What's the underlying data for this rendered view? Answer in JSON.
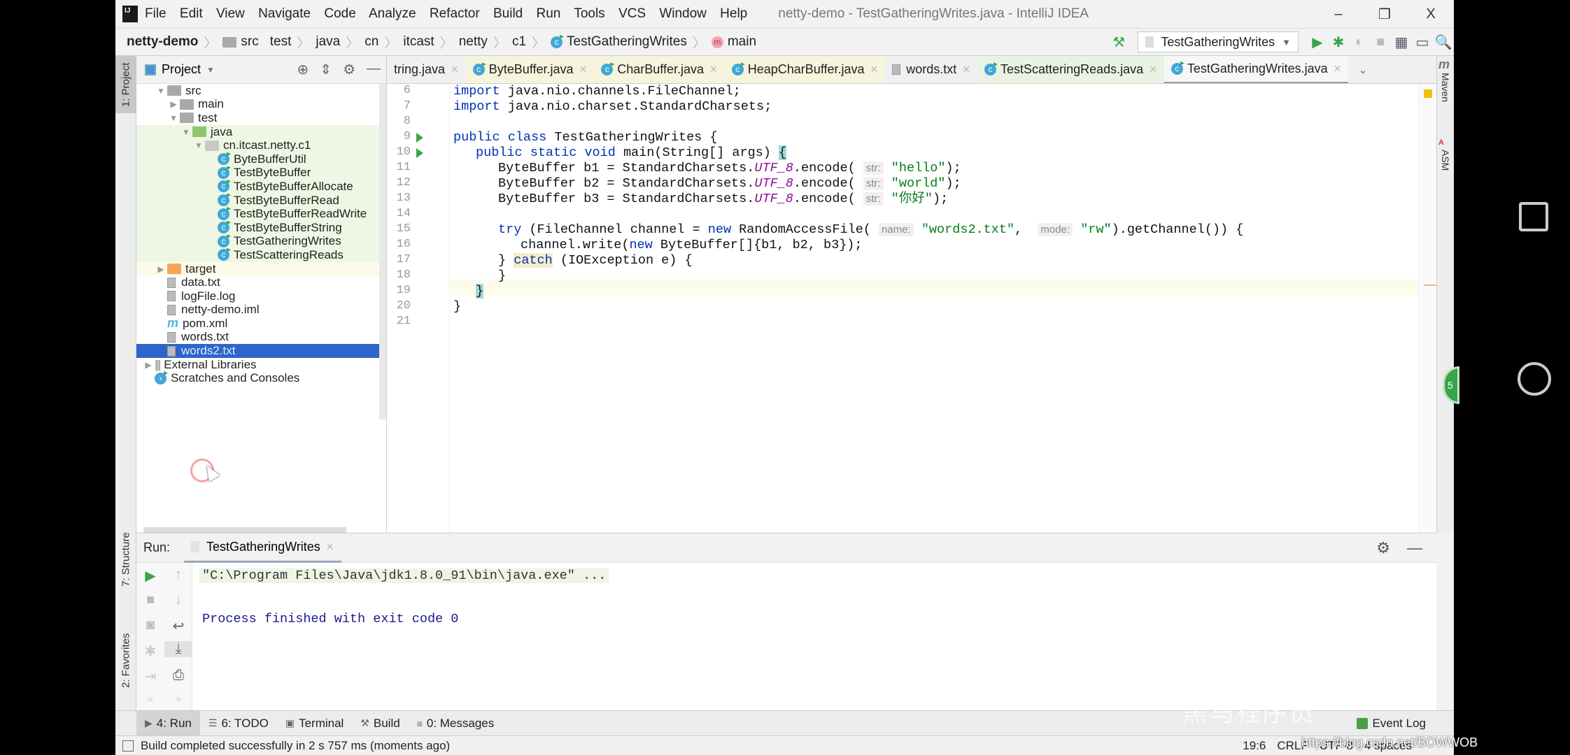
{
  "window": {
    "title": "netty-demo - TestGatheringWrites.java - IntelliJ IDEA",
    "menu": [
      "File",
      "Edit",
      "View",
      "Navigate",
      "Code",
      "Analyze",
      "Refactor",
      "Build",
      "Run",
      "Tools",
      "VCS",
      "Window",
      "Help"
    ],
    "controls": {
      "minimize": "–",
      "restore": "❐",
      "close": "X"
    }
  },
  "navbar": {
    "breadcrumb": [
      "netty-demo",
      "src",
      "test",
      "java",
      "cn",
      "itcast",
      "netty",
      "c1",
      "TestGatheringWrites",
      "main"
    ],
    "run_config": "TestGatheringWrites"
  },
  "left_strip": {
    "project": "1: Project",
    "structure": "7: Structure",
    "favorites": "2: Favorites"
  },
  "project_pane": {
    "title": "Project",
    "tree": [
      {
        "label": "src",
        "indent": 1,
        "arrow": "down",
        "icon": "folder"
      },
      {
        "label": "main",
        "indent": 2,
        "arrow": "right",
        "icon": "folder"
      },
      {
        "label": "test",
        "indent": 2,
        "arrow": "down",
        "icon": "folder"
      },
      {
        "label": "java",
        "indent": 3,
        "arrow": "down",
        "icon": "java-folder"
      },
      {
        "label": "cn.itcast.netty.c1",
        "indent": 4,
        "arrow": "down",
        "icon": "package"
      },
      {
        "label": "ByteBufferUtil",
        "indent": 5,
        "icon": "class"
      },
      {
        "label": "TestByteBuffer",
        "indent": 5,
        "icon": "class"
      },
      {
        "label": "TestByteBufferAllocate",
        "indent": 5,
        "icon": "class"
      },
      {
        "label": "TestByteBufferRead",
        "indent": 5,
        "icon": "class"
      },
      {
        "label": "TestByteBufferReadWrite",
        "indent": 5,
        "icon": "class"
      },
      {
        "label": "TestByteBufferString",
        "indent": 5,
        "icon": "class"
      },
      {
        "label": "TestGatheringWrites",
        "indent": 5,
        "icon": "class"
      },
      {
        "label": "TestScatteringReads",
        "indent": 5,
        "icon": "class"
      },
      {
        "label": "target",
        "indent": 1,
        "arrow": "right",
        "icon": "target-folder"
      },
      {
        "label": "data.txt",
        "indent": 1,
        "icon": "file"
      },
      {
        "label": "logFile.log",
        "indent": 1,
        "icon": "file"
      },
      {
        "label": "netty-demo.iml",
        "indent": 1,
        "icon": "file"
      },
      {
        "label": "pom.xml",
        "indent": 1,
        "icon": "maven"
      },
      {
        "label": "words.txt",
        "indent": 1,
        "icon": "file"
      },
      {
        "label": "words2.txt",
        "indent": 1,
        "icon": "file",
        "selected": true
      },
      {
        "label": "External Libraries",
        "indent": 0,
        "arrow": "right",
        "icon": "library"
      },
      {
        "label": "Scratches and Consoles",
        "indent": 0,
        "icon": "scratches"
      }
    ]
  },
  "editor": {
    "tabs": [
      {
        "label": "String.java",
        "visible_label": "tring.java",
        "style": "plain"
      },
      {
        "label": "ByteBuffer.java",
        "style": "yellow"
      },
      {
        "label": "CharBuffer.java",
        "style": "yellow"
      },
      {
        "label": "HeapCharBuffer.java",
        "style": "yellow"
      },
      {
        "label": "words.txt",
        "style": "plain"
      },
      {
        "label": "TestScatteringReads.java",
        "style": "green"
      },
      {
        "label": "TestGatheringWrites.java",
        "style": "active"
      }
    ],
    "lines": [
      {
        "n": "6"
      },
      {
        "n": "7"
      },
      {
        "n": "8"
      },
      {
        "n": "9"
      },
      {
        "n": "10"
      },
      {
        "n": "11"
      },
      {
        "n": "12"
      },
      {
        "n": "13"
      },
      {
        "n": "14"
      },
      {
        "n": "15"
      },
      {
        "n": "16"
      },
      {
        "n": "17"
      },
      {
        "n": "18"
      },
      {
        "n": "19"
      },
      {
        "n": "20"
      },
      {
        "n": "21"
      }
    ],
    "code": {
      "l6": {
        "kw": "import",
        "rest": " java.nio.channels.FileChannel;"
      },
      "l7": {
        "kw": "import",
        "rest": " java.nio.charset.StandardCharsets;"
      },
      "l9": {
        "kw": "public class",
        "rest": " TestGatheringWrites {"
      },
      "l10": {
        "kw": "public static void",
        "rest": " main(String[] args) ",
        "brace": "{"
      },
      "l11": {
        "pre": "ByteBuffer b1 = StandardCharsets.",
        "it": "UTF_8",
        "post": ".encode( ",
        "hint": "str:",
        "str": "\"hello\"",
        "end": ");"
      },
      "l12": {
        "pre": "ByteBuffer b2 = StandardCharsets.",
        "it": "UTF_8",
        "post": ".encode( ",
        "hint": "str:",
        "str": "\"world\"",
        "end": ");"
      },
      "l13": {
        "pre": "ByteBuffer b3 = StandardCharsets.",
        "it": "UTF_8",
        "post": ".encode( ",
        "hint": "str:",
        "str": "\"你好\"",
        "end": ");"
      },
      "l15": {
        "kw": "try",
        "a": " (FileChannel channel = ",
        "kw2": "new",
        "b": " RandomAccessFile( ",
        "hint1": "name:",
        "str1": "\"words2.txt\"",
        "c": ",  ",
        "hint2": "mode:",
        "str2": "\"rw\"",
        "d": ").getChannel()) {"
      },
      "l16": {
        "a": "channel.write(",
        "kw": "new",
        "b": " ByteBuffer[]{b1, b2, b3});"
      },
      "l17": {
        "a": "} ",
        "kw": "catch",
        "b": " (IOException e) {"
      },
      "l18": {
        "a": "}"
      },
      "l19": {
        "brace": "}"
      },
      "l20": {
        "a": "}"
      }
    }
  },
  "right_strip": {
    "maven": "Maven",
    "asm": "ASM"
  },
  "run_panel": {
    "label": "Run:",
    "tab": "TestGatheringWrites",
    "console": {
      "command": "\"C:\\Program Files\\Java\\jdk1.8.0_91\\bin\\java.exe\" ...",
      "exit": "Process finished with exit code 0"
    }
  },
  "bottom_tabs": [
    {
      "label": "4: Run",
      "icon": "▶",
      "active": true
    },
    {
      "label": "6: TODO",
      "icon": "☰"
    },
    {
      "label": "Terminal",
      "icon": "▣"
    },
    {
      "label": "Build",
      "icon": "🔨"
    },
    {
      "label": "0: Messages",
      "icon": "≡"
    }
  ],
  "event_log": "Event Log",
  "status": {
    "message": "Build completed successfully in 2 s 757 ms (moments ago)",
    "position": "19:6",
    "line_sep": "CRLF",
    "encoding": "UTF-8",
    "indent": "4 spaces"
  },
  "overlay": {
    "watermark_url": "https://blog.csdn.net/BOWWOB",
    "watermark_cn": "黑马程序员",
    "bubble": "5"
  }
}
